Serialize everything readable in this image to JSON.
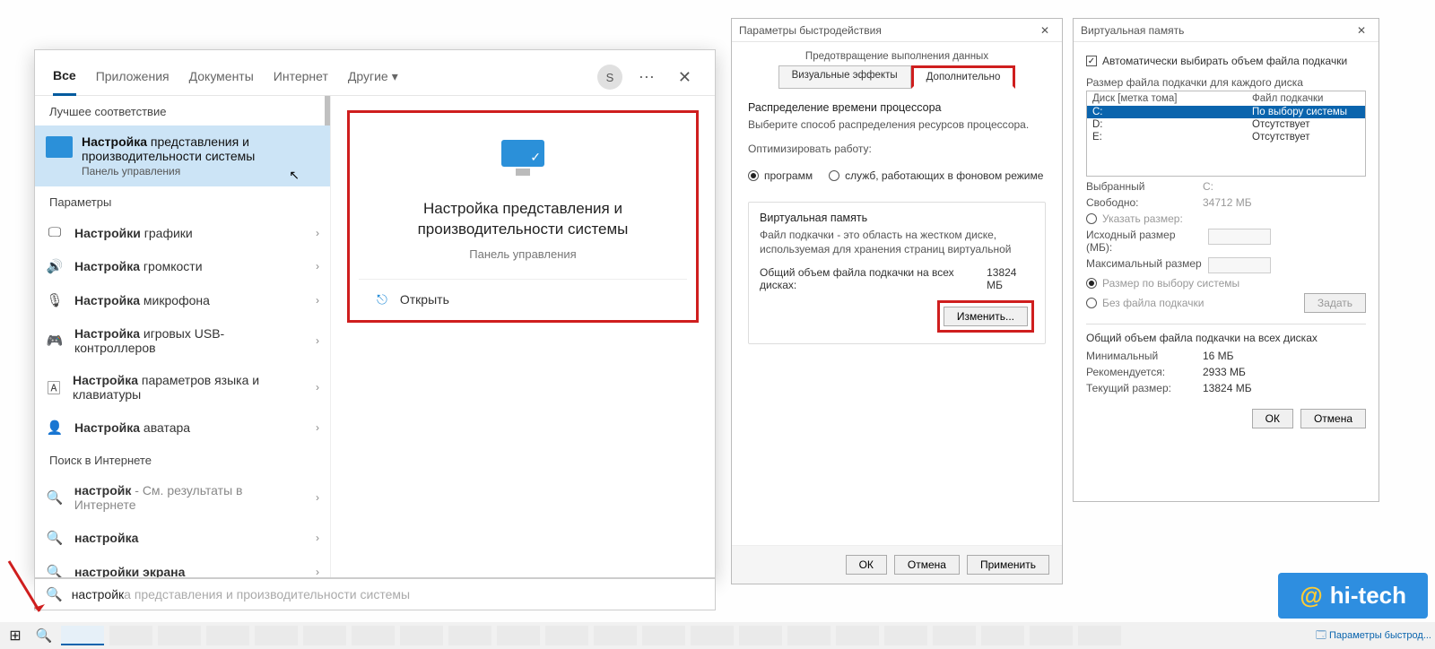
{
  "search": {
    "tabs": {
      "all": "Все",
      "apps": "Приложения",
      "docs": "Документы",
      "web": "Интернет",
      "more": "Другие"
    },
    "avatar_letter": "S",
    "group_best": "Лучшее соответствие",
    "best_match": {
      "bold": "Настройка",
      "rest": " представления и производительности системы",
      "sub": "Панель управления"
    },
    "group_params": "Параметры",
    "rows": [
      {
        "icon": "🖵",
        "bold": "Настройки",
        "rest": " графики"
      },
      {
        "icon": "🔊",
        "bold": "Настройка",
        "rest": " громкости"
      },
      {
        "icon": "🎙",
        "bold": "Настройка",
        "rest": " микрофона"
      },
      {
        "icon": "🎮",
        "bold": "Настройка",
        "rest": " игровых USB-контроллеров"
      },
      {
        "icon": "🄰",
        "bold": "Настройка",
        "rest": " параметров языка и клавиатуры"
      },
      {
        "icon": "👤",
        "bold": "Настройка",
        "rest": " аватара"
      }
    ],
    "group_web": "Поиск в Интернете",
    "web_rows": [
      {
        "bold": "настройк",
        "rest": " - См. результаты в Интернете"
      },
      {
        "bold": "настройка",
        "rest": ""
      },
      {
        "bold": "настройки экрана",
        "rest": ""
      }
    ],
    "preview_title": "Настройка представления и производительности системы",
    "preview_sub": "Панель управления",
    "open_label": "Открыть",
    "input_typed": "настройк",
    "input_ghost": "а представления и производительности системы"
  },
  "perf": {
    "title": "Параметры быстродействия",
    "tab_top": "Предотвращение выполнения данных",
    "tab_visual": "Визуальные эффекты",
    "tab_adv": "Дополнительно",
    "proc_header": "Распределение времени процессора",
    "proc_text": "Выберите способ распределения ресурсов процессора.",
    "opt_label": "Оптимизировать работу:",
    "opt_programs": "программ",
    "opt_services": "служб, работающих в фоновом режиме",
    "vm_header": "Виртуальная память",
    "vm_text": "Файл подкачки - это область на жестком диске, используемая для хранения страниц виртуальной",
    "vm_total_label": "Общий объем файла подкачки на всех дисках:",
    "vm_total_val": "13824 МБ",
    "change_btn": "Изменить...",
    "ok": "ОК",
    "cancel": "Отмена",
    "apply": "Применить"
  },
  "vm": {
    "title": "Виртуальная память",
    "auto_chk": "Автоматически выбирать объем файла подкачки",
    "list_label": "Размер файла подкачки для каждого диска",
    "col_disk": "Диск [метка тома]",
    "col_file": "Файл подкачки",
    "rows": [
      {
        "d": "C:",
        "f": "По выбору системы",
        "sel": true
      },
      {
        "d": "D:",
        "f": "Отсутствует",
        "sel": false
      },
      {
        "d": "E:",
        "f": "Отсутствует",
        "sel": false
      }
    ],
    "selected_label": "Выбранный",
    "selected_val": "C:",
    "free_label": "Свободно:",
    "free_val": "34712 МБ",
    "opt_custom": "Указать размер:",
    "initial_label": "Исходный размер (МБ):",
    "max_label": "Максимальный размер",
    "opt_system": "Размер по выбору системы",
    "opt_none": "Без файла подкачки",
    "set_btn": "Задать",
    "totals_header": "Общий объем файла подкачки на всех дисках",
    "min_label": "Минимальный",
    "min_val": "16 МБ",
    "rec_label": "Рекомендуется:",
    "rec_val": "2933 МБ",
    "cur_label": "Текущий размер:",
    "cur_val": "13824 МБ",
    "ok": "ОК",
    "cancel": "Отмена"
  },
  "taskbar": {
    "tray_item": "Параметры быстрод..."
  },
  "watermark": {
    "at": "@",
    "text": "hi-tech"
  }
}
